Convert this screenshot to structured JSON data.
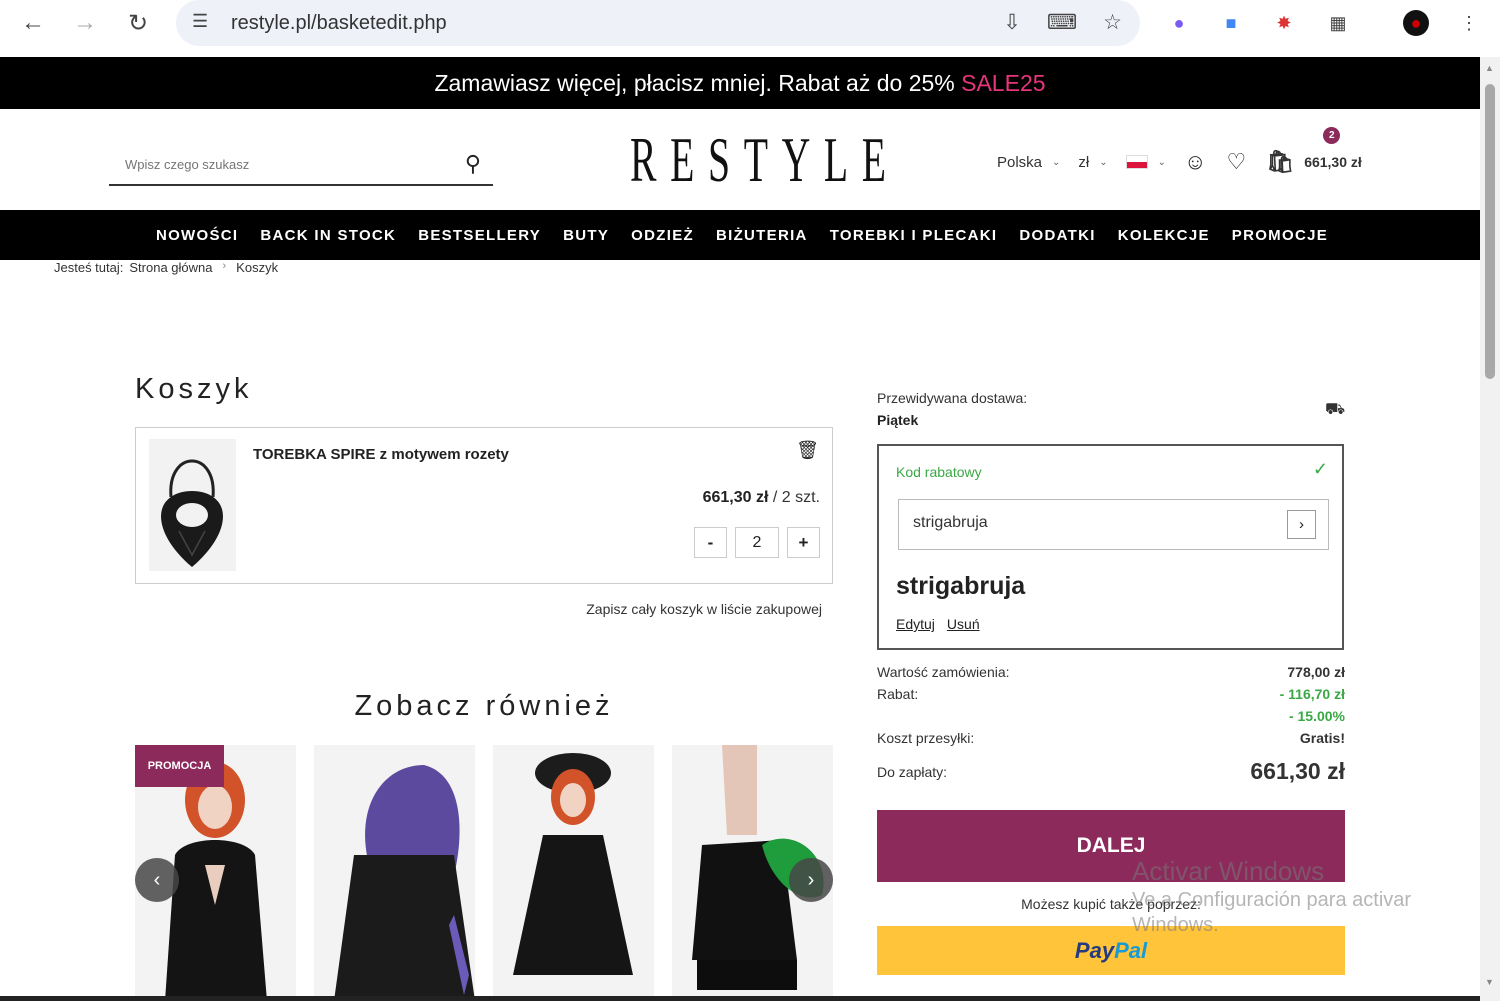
{
  "browser": {
    "url": "restyle.pl/basketedit.php"
  },
  "promo_bar": {
    "text": "Zamawiasz więcej, płacisz mniej. Rabat aż do 25%",
    "code": "SALE25"
  },
  "header": {
    "search_placeholder": "Wpisz czego szukasz",
    "logo": "RESTYLE",
    "country": "Polska",
    "currency": "zł",
    "cart_count": "2",
    "cart_total": "661,30 zł"
  },
  "nav": {
    "items": [
      "NOWOŚCI",
      "BACK IN STOCK",
      "BESTSELLERY",
      "BUTY",
      "ODZIEŻ",
      "BIŻUTERIA",
      "TOREBKI I PLECAKI",
      "DODATKI",
      "KOLEKCJE",
      "PROMOCJE"
    ]
  },
  "breadcrumb": {
    "prefix": "Jesteś tutaj:",
    "home": "Strona główna",
    "current": "Koszyk"
  },
  "cart": {
    "title": "Koszyk",
    "item": {
      "name": "TOREBKA SPIRE z motywem rozety",
      "price": "661,30 zł",
      "qty_text": "/ 2 szt.",
      "qty": "2",
      "minus": "-",
      "plus": "+"
    },
    "save_list": "Zapisz cały koszyk w liście zakupowej"
  },
  "see_also": {
    "title": "Zobacz również",
    "promo_tag": "PROMOCJA"
  },
  "summary": {
    "delivery_label": "Przewidywana dostawa:",
    "delivery_value": "Piątek",
    "coupon_label": "Kod rabatowy",
    "coupon_input": "strigabruja",
    "coupon_code": "strigabruja",
    "edit": "Edytuj",
    "remove": "Usuń",
    "order_value_label": "Wartość zamówienia:",
    "order_value": "778,00 zł",
    "discount_label": "Rabat:",
    "discount_value": "- 116,70 zł",
    "discount_pct": "- 15.00%",
    "shipping_label": "Koszt przesyłki:",
    "shipping_value": "Gratis!",
    "total_label": "Do zapłaty:",
    "total_value": "661,30 zł",
    "next_button": "DALEJ",
    "buy_also": "Możesz kupić także poprzez:",
    "paypal_1": "Pay",
    "paypal_2": "Pal"
  },
  "watermark": {
    "line1": "Activar Windows",
    "line2": "Ve a Configuración para activar",
    "line3": "Windows."
  },
  "colors": {
    "brand": "#8b2a5b",
    "promo_code": "#e6357a",
    "success": "#3aa845",
    "paypal": "#ffc439"
  }
}
